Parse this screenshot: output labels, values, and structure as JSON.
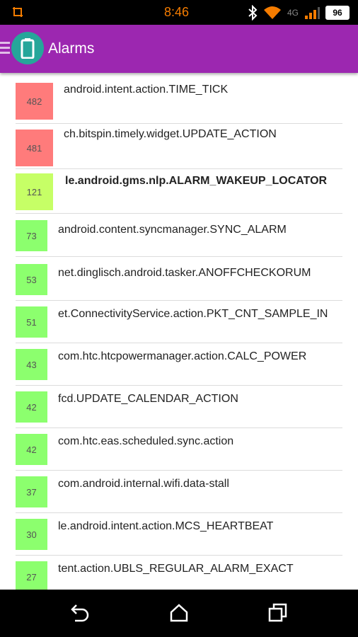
{
  "status_bar": {
    "time": "8:46",
    "battery": "96",
    "network": "4G",
    "icons": [
      "screenshot-icon",
      "bluetooth-icon",
      "wifi-icon",
      "signal-icon",
      "battery-icon"
    ],
    "accent_color": "#f57c00"
  },
  "app_bar": {
    "title": "Alarms",
    "color": "#9c27b0",
    "icon": "battery-app-icon"
  },
  "alarms": [
    {
      "count": "482",
      "name": "android.intent.action.TIME_TICK",
      "color": "#ff7b7b"
    },
    {
      "count": "481",
      "name": "ch.bitspin.timely.widget.UPDATE_ACTION",
      "color": "#ff7b7b"
    },
    {
      "count": "121",
      "name": "le.android.gms.nlp.ALARM_WAKEUP_LOCATOR",
      "color": "#c6ff66"
    },
    {
      "count": "73",
      "name": "android.content.syncmanager.SYNC_ALARM",
      "color": "#8cff6e"
    },
    {
      "count": "53",
      "name": "net.dinglisch.android.tasker.ANOFFCHECKORUM",
      "color": "#8cff6e"
    },
    {
      "count": "51",
      "name": "et.ConnectivityService.action.PKT_CNT_SAMPLE_IN",
      "color": "#8cff6e"
    },
    {
      "count": "43",
      "name": "com.htc.htcpowermanager.action.CALC_POWER",
      "color": "#8cff6e"
    },
    {
      "count": "42",
      "name": "fcd.UPDATE_CALENDAR_ACTION",
      "color": "#8cff6e"
    },
    {
      "count": "42",
      "name": "com.htc.eas.scheduled.sync.action",
      "color": "#8cff6e"
    },
    {
      "count": "37",
      "name": "com.android.internal.wifi.data-stall",
      "color": "#8cff6e"
    },
    {
      "count": "30",
      "name": "le.android.intent.action.MCS_HEARTBEAT",
      "color": "#8cff6e"
    },
    {
      "count": "27",
      "name": "tent.action.UBLS_REGULAR_ALARM_EXACT",
      "color": "#8cff6e"
    }
  ],
  "nav_bar": {
    "buttons": [
      "back-icon",
      "home-icon",
      "recents-icon"
    ]
  }
}
